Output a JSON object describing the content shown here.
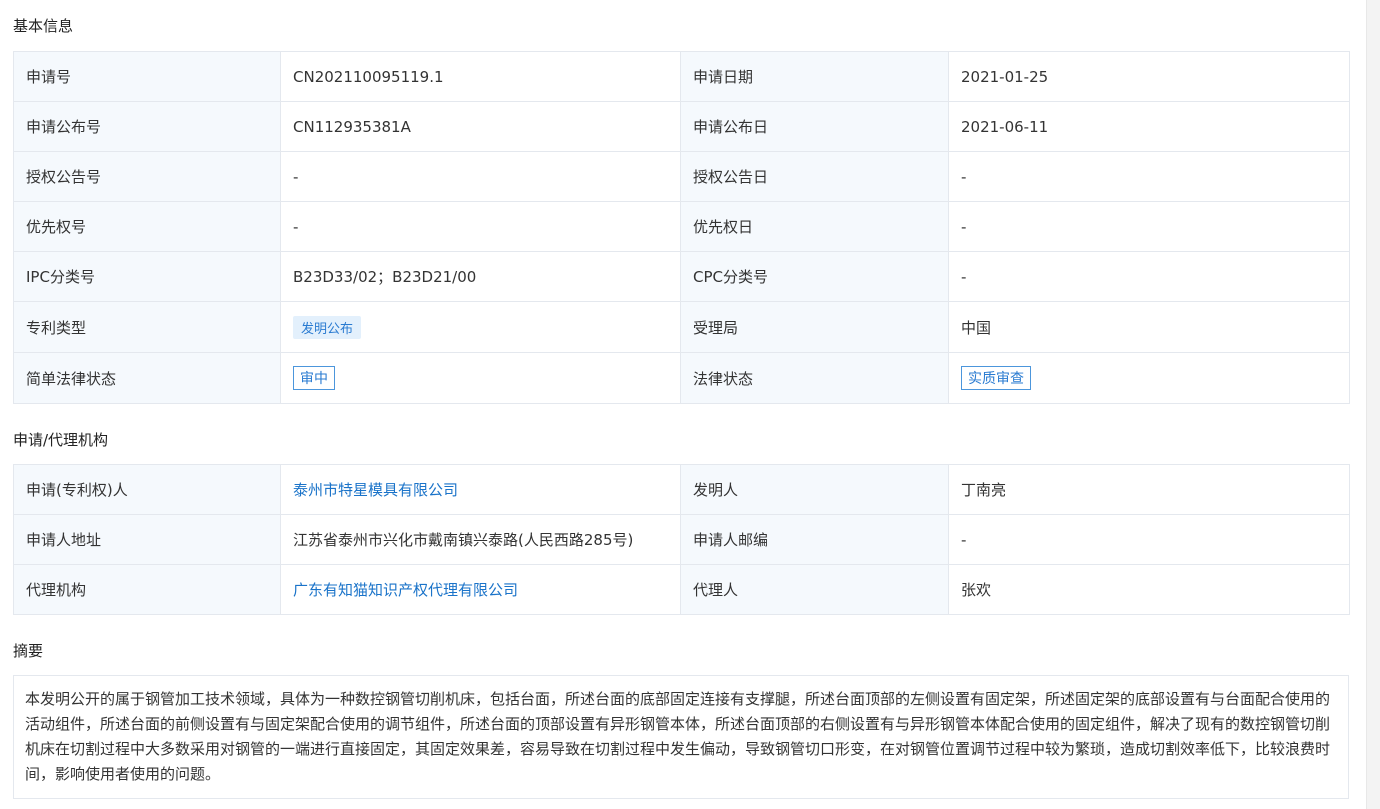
{
  "sections": {
    "basic": "基本信息",
    "agency": "申请/代理机构",
    "abstract": "摘要"
  },
  "basic": {
    "rows": [
      {
        "l1": "申请号",
        "v1": "CN202110095119.1",
        "l2": "申请日期",
        "v2": "2021-01-25"
      },
      {
        "l1": "申请公布号",
        "v1": "CN112935381A",
        "l2": "申请公布日",
        "v2": "2021-06-11"
      },
      {
        "l1": "授权公告号",
        "v1": "-",
        "l2": "授权公告日",
        "v2": "-"
      },
      {
        "l1": "优先权号",
        "v1": "-",
        "l2": "优先权日",
        "v2": "-"
      },
      {
        "l1": "IPC分类号",
        "v1": "B23D33/02；B23D21/00",
        "l2": "CPC分类号",
        "v2": "-"
      },
      {
        "l1": "专利类型",
        "v1": "发明公布",
        "l2": "受理局",
        "v2": "中国"
      },
      {
        "l1": "简单法律状态",
        "v1": "审中",
        "l2": "法律状态",
        "v2": "实质审查"
      }
    ]
  },
  "agency": {
    "rows": [
      {
        "l1": "申请(专利权)人",
        "v1": "泰州市特星模具有限公司",
        "l2": "发明人",
        "v2": "丁南亮"
      },
      {
        "l1": "申请人地址",
        "v1": "江苏省泰州市兴化市戴南镇兴泰路(人民西路285号)",
        "l2": "申请人邮编",
        "v2": "-"
      },
      {
        "l1": "代理机构",
        "v1": "广东有知猫知识产权代理有限公司",
        "l2": "代理人",
        "v2": "张欢"
      }
    ]
  },
  "abstract": {
    "text": "本发明公开的属于钢管加工技术领域，具体为一种数控钢管切削机床，包括台面，所述台面的底部固定连接有支撑腿，所述台面顶部的左侧设置有固定架，所述固定架的底部设置有与台面配合使用的活动组件，所述台面的前侧设置有与固定架配合使用的调节组件，所述台面的顶部设置有异形钢管本体，所述台面顶部的右侧设置有与异形钢管本体配合使用的固定组件，解决了现有的数控钢管切削机床在切割过程中大多数采用对钢管的一端进行直接固定，其固定效果差，容易导致在切割过程中发生偏动，导致钢管切口形变，在对钢管位置调节过程中较为繁琐，造成切割效率低下，比较浪费时间，影响使用者使用的问题。"
  },
  "colors": {
    "label_bg": "#f5f9fd",
    "border": "#e4e8ee",
    "link": "#1a73c9",
    "tag_fill_bg": "#e3f0fc",
    "tag_outline_border": "#4c96dc"
  }
}
